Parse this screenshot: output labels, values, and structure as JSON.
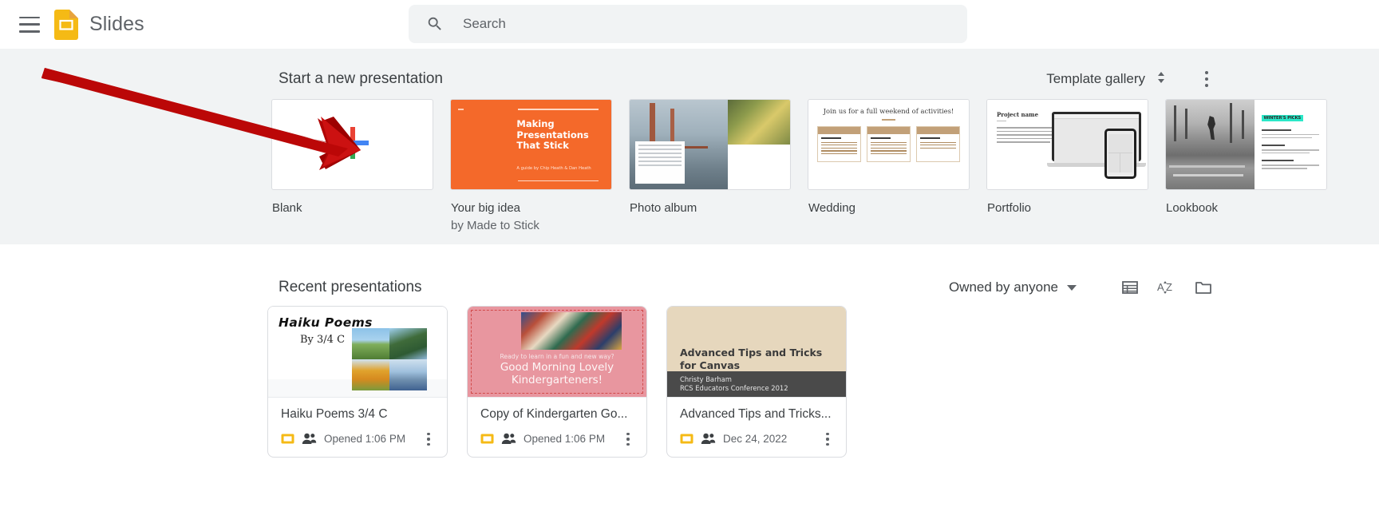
{
  "topbar": {
    "menu_icon": "hamburger-menu-icon",
    "app_logo_icon": "google-slides-logo-icon",
    "app_title": "Slides",
    "search": {
      "icon": "search-icon",
      "placeholder": "Search",
      "value": ""
    }
  },
  "new_presentation": {
    "section_title": "Start a new presentation",
    "template_gallery_label": "Template gallery",
    "template_gallery_icon": "chevron-up-down-icon",
    "more_icon": "kebab-menu-icon",
    "templates": [
      {
        "name": "Blank",
        "subtitle": "",
        "thumb": "plus-icon"
      },
      {
        "name": "Your big idea",
        "subtitle": "by Made to Stick",
        "thumb_title": "Making Presentations That Stick",
        "thumb_credit": "A guide by Chip Heath & Dan Heath"
      },
      {
        "name": "Photo album",
        "subtitle": "",
        "thumb": "photo-collage"
      },
      {
        "name": "Wedding",
        "subtitle": "",
        "thumb_title": "Join us for a full weekend of activities!",
        "thumb_cols": [
          "Thursday",
          "Friday",
          "Sunday"
        ],
        "thumb_col_subs": [
          "apéritif at 6pm",
          "aperitif at 7am",
          "brunch at noon"
        ]
      },
      {
        "name": "Portfolio",
        "subtitle": "",
        "thumb_title": "Project name"
      },
      {
        "name": "Lookbook",
        "subtitle": "",
        "thumb_title": "WINTER'S PICKS",
        "thumb_items": [
          "Offbeat Tariff Cap",
          "Bowsher Knot",
          "Parlor Hightops"
        ]
      }
    ]
  },
  "recent": {
    "section_title": "Recent presentations",
    "owner_filter_label": "Owned by anyone",
    "owner_filter_icon": "caret-down-icon",
    "list_view_icon": "list-view-icon",
    "sort_icon": "sort-az-icon",
    "folder_icon": "folder-icon",
    "documents": [
      {
        "name": "Haiku Poems 3/4 C",
        "timestamp": "Opened 1:06 PM",
        "type_icon": "slides-file-icon",
        "shared_icon": "shared-people-icon",
        "menu_icon": "kebab-menu-icon",
        "thumb_title": "Haiku Poems",
        "thumb_subtitle": "By 3/4 C"
      },
      {
        "name": "Copy of Kindergarten Go...",
        "timestamp": "Opened 1:06 PM",
        "type_icon": "slides-file-icon",
        "shared_icon": "shared-people-icon",
        "menu_icon": "kebab-menu-icon",
        "thumb_subtitle": "Ready to learn in a fun and new way?",
        "thumb_title": "Good Morning Lovely Kindergarteners!"
      },
      {
        "name": "Advanced Tips and Tricks...",
        "timestamp": "Dec 24, 2022",
        "type_icon": "slides-file-icon",
        "shared_icon": "shared-people-icon",
        "menu_icon": "kebab-menu-icon",
        "thumb_title": "Advanced Tips and Tricks for Canvas",
        "thumb_author": "Christy Barham",
        "thumb_event": "RCS Educators Conference 2012"
      }
    ]
  },
  "annotation": {
    "arrow_icon": "red-arrow-pointer",
    "arrow_color": "#cc0000",
    "points_to": "Blank"
  },
  "colors": {
    "slides_yellow": "#f5ba15",
    "panel_gray": "#f1f3f4",
    "text_primary": "#3c4043",
    "text_secondary": "#5f6368",
    "border": "#dadce0",
    "annotation_red": "#cc0000"
  }
}
